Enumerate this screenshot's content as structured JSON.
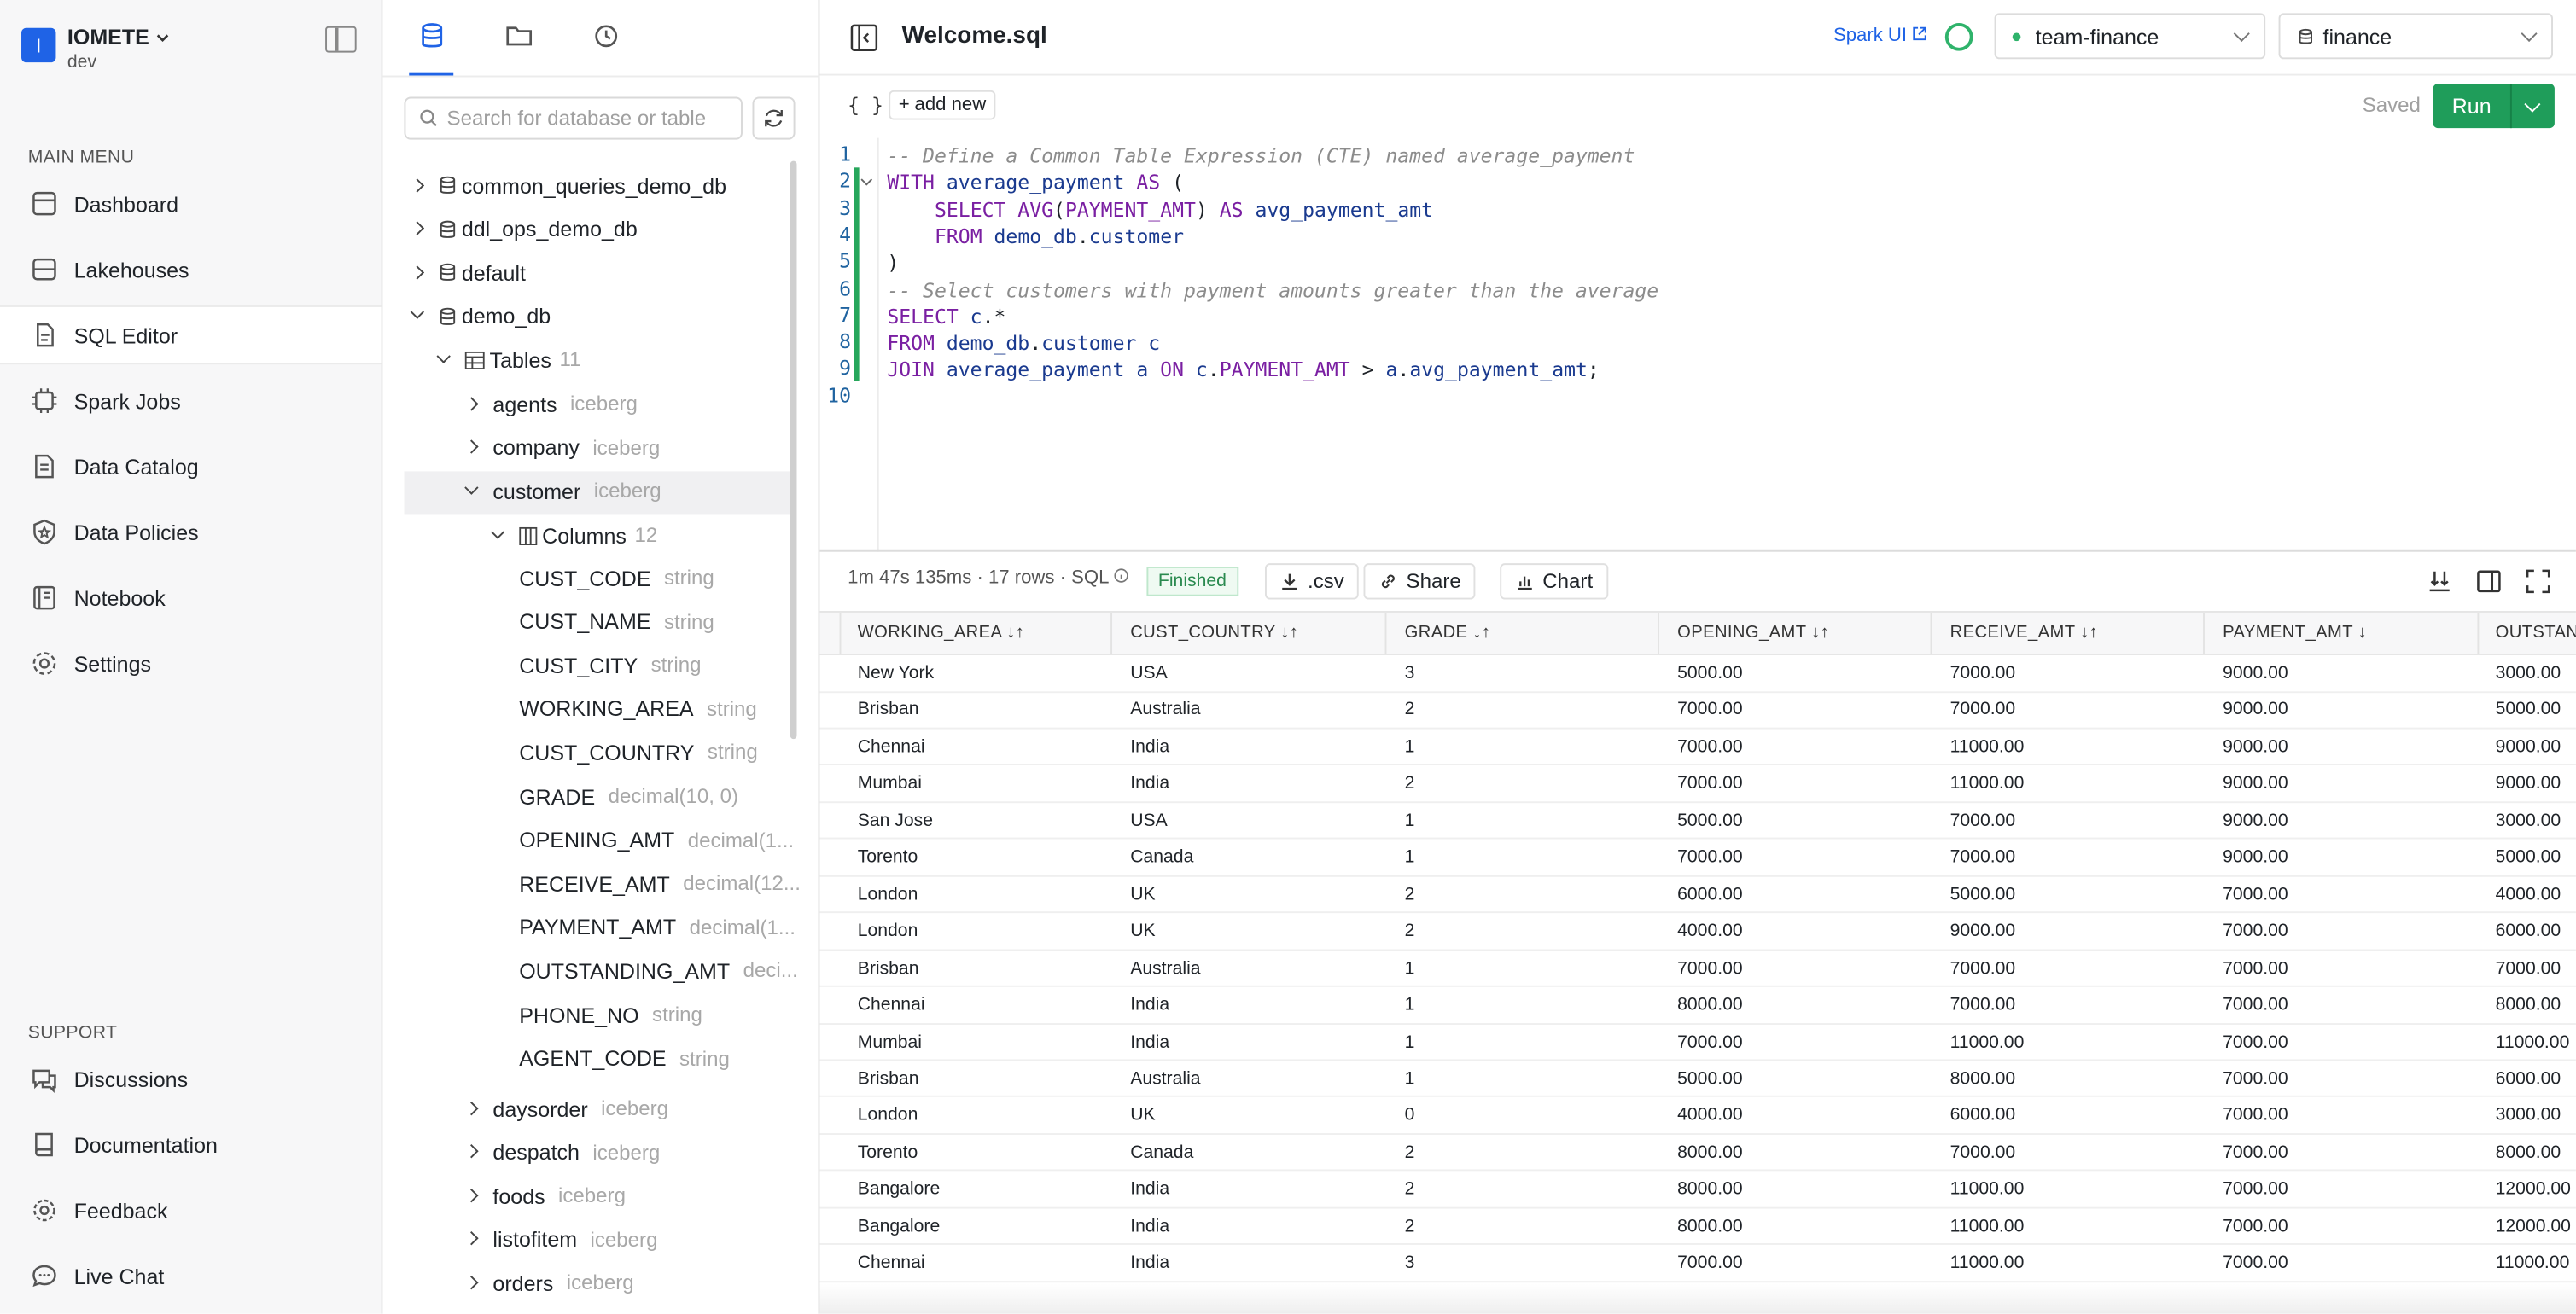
{
  "brand": {
    "logo_letter": "I",
    "name": "IOMETE",
    "env": "dev"
  },
  "sidebar": {
    "main_menu_label": "MAIN MENU",
    "items": [
      {
        "label": "Dashboard",
        "icon": "dashboard-icon"
      },
      {
        "label": "Lakehouses",
        "icon": "lakehouse-icon"
      },
      {
        "label": "SQL Editor",
        "icon": "sql-editor-icon"
      },
      {
        "label": "Spark Jobs",
        "icon": "spark-jobs-icon"
      },
      {
        "label": "Data Catalog",
        "icon": "data-catalog-icon"
      },
      {
        "label": "Data Policies",
        "icon": "data-policies-icon"
      },
      {
        "label": "Notebook",
        "icon": "notebook-icon"
      },
      {
        "label": "Settings",
        "icon": "settings-icon"
      }
    ],
    "support_label": "SUPPORT",
    "support_items": [
      {
        "label": "Discussions"
      },
      {
        "label": "Documentation"
      },
      {
        "label": "Feedback"
      },
      {
        "label": "Live Chat"
      }
    ]
  },
  "explorer": {
    "search_placeholder": "Search for database or table",
    "dbs": [
      "common_queries_demo_db",
      "ddl_ops_demo_db",
      "default",
      "demo_db"
    ],
    "tables_label": "Tables",
    "tables_count": "11",
    "tables_before": [
      {
        "name": "agents",
        "fmt": "iceberg"
      },
      {
        "name": "company",
        "fmt": "iceberg"
      },
      {
        "name": "customer",
        "fmt": "iceberg"
      }
    ],
    "columns_label": "Columns",
    "columns_count": "12",
    "columns": [
      {
        "name": "CUST_CODE",
        "type": "string"
      },
      {
        "name": "CUST_NAME",
        "type": "string"
      },
      {
        "name": "CUST_CITY",
        "type": "string"
      },
      {
        "name": "WORKING_AREA",
        "type": "string"
      },
      {
        "name": "CUST_COUNTRY",
        "type": "string"
      },
      {
        "name": "GRADE",
        "type": "decimal(10, 0)"
      },
      {
        "name": "OPENING_AMT",
        "type": "decimal(1..."
      },
      {
        "name": "RECEIVE_AMT",
        "type": "decimal(12..."
      },
      {
        "name": "PAYMENT_AMT",
        "type": "decimal(1..."
      },
      {
        "name": "OUTSTANDING_AMT",
        "type": "deci..."
      },
      {
        "name": "PHONE_NO",
        "type": "string"
      },
      {
        "name": "AGENT_CODE",
        "type": "string"
      }
    ],
    "tables_after": [
      {
        "name": "daysorder",
        "fmt": "iceberg"
      },
      {
        "name": "despatch",
        "fmt": "iceberg"
      },
      {
        "name": "foods",
        "fmt": "iceberg"
      },
      {
        "name": "listofitem",
        "fmt": "iceberg"
      },
      {
        "name": "orders",
        "fmt": "iceberg"
      }
    ]
  },
  "editor": {
    "file_name": "Welcome.sql",
    "spark_ui": "Spark UI",
    "cluster": "team-finance",
    "catalog": "finance",
    "braces": "{ }",
    "add_new": "add new",
    "saved": "Saved",
    "run": "Run",
    "line_numbers": [
      "1",
      "2",
      "3",
      "4",
      "5",
      "6",
      "7",
      "8",
      "9",
      "10"
    ],
    "lines": [
      [
        [
          "cm",
          "-- Define a Common Table Expression (CTE) named average_payment"
        ]
      ],
      [
        [
          "kw",
          "WITH "
        ],
        [
          "id",
          "average_payment "
        ],
        [
          "kw",
          "AS "
        ],
        [
          "pl",
          "("
        ]
      ],
      [
        [
          "pl",
          "    "
        ],
        [
          "kw",
          "SELECT AVG"
        ],
        [
          "pl",
          "("
        ],
        [
          "kw",
          "PAYMENT_AMT"
        ],
        [
          "pl",
          ") "
        ],
        [
          "kw",
          "AS "
        ],
        [
          "id",
          "avg_payment_amt"
        ]
      ],
      [
        [
          "pl",
          "    "
        ],
        [
          "kw",
          "FROM "
        ],
        [
          "id",
          "demo_db"
        ],
        [
          "pl",
          "."
        ],
        [
          "id",
          "customer"
        ]
      ],
      [
        [
          "pl",
          ")"
        ]
      ],
      [
        [
          "cm",
          "-- Select customers with payment amounts greater than the average"
        ]
      ],
      [
        [
          "kw",
          "SELECT "
        ],
        [
          "id",
          "c"
        ],
        [
          "pl",
          ".*"
        ]
      ],
      [
        [
          "kw",
          "FROM "
        ],
        [
          "id",
          "demo_db"
        ],
        [
          "pl",
          "."
        ],
        [
          "id",
          "customer c"
        ]
      ],
      [
        [
          "kw",
          "JOIN "
        ],
        [
          "id",
          "average_payment a "
        ],
        [
          "kw",
          "ON "
        ],
        [
          "id",
          "c"
        ],
        [
          "pl",
          "."
        ],
        [
          "kw",
          "PAYMENT_AMT"
        ],
        [
          "pl",
          " > "
        ],
        [
          "id",
          "a"
        ],
        [
          "pl",
          "."
        ],
        [
          "id",
          "avg_payment_amt"
        ],
        [
          "pl",
          ";"
        ]
      ],
      []
    ]
  },
  "results": {
    "stats": "1m 47s 135ms · 17 rows · SQL",
    "status": "Finished",
    "csv": ".csv",
    "share": "Share",
    "chart": "Chart",
    "columns": [
      "WORKING_AREA ↓↑",
      "CUST_COUNTRY ↓↑",
      "GRADE ↓↑",
      "OPENING_AMT ↓↑",
      "RECEIVE_AMT ↓↑",
      "PAYMENT_AMT ↓",
      "OUTSTAN"
    ],
    "rows": [
      [
        "New York",
        "USA",
        "3",
        "5000.00",
        "7000.00",
        "9000.00",
        "3000.00"
      ],
      [
        "Brisban",
        "Australia",
        "2",
        "7000.00",
        "7000.00",
        "9000.00",
        "5000.00"
      ],
      [
        "Chennai",
        "India",
        "1",
        "7000.00",
        "11000.00",
        "9000.00",
        "9000.00"
      ],
      [
        "Mumbai",
        "India",
        "2",
        "7000.00",
        "11000.00",
        "9000.00",
        "9000.00"
      ],
      [
        "San Jose",
        "USA",
        "1",
        "5000.00",
        "7000.00",
        "9000.00",
        "3000.00"
      ],
      [
        "Torento",
        "Canada",
        "1",
        "7000.00",
        "7000.00",
        "9000.00",
        "5000.00"
      ],
      [
        "London",
        "UK",
        "2",
        "6000.00",
        "5000.00",
        "7000.00",
        "4000.00"
      ],
      [
        "London",
        "UK",
        "2",
        "4000.00",
        "9000.00",
        "7000.00",
        "6000.00"
      ],
      [
        "Brisban",
        "Australia",
        "1",
        "7000.00",
        "7000.00",
        "7000.00",
        "7000.00"
      ],
      [
        "Chennai",
        "India",
        "1",
        "8000.00",
        "7000.00",
        "7000.00",
        "8000.00"
      ],
      [
        "Mumbai",
        "India",
        "1",
        "7000.00",
        "11000.00",
        "7000.00",
        "11000.00"
      ],
      [
        "Brisban",
        "Australia",
        "1",
        "5000.00",
        "8000.00",
        "7000.00",
        "6000.00"
      ],
      [
        "London",
        "UK",
        "0",
        "4000.00",
        "6000.00",
        "7000.00",
        "3000.00"
      ],
      [
        "Torento",
        "Canada",
        "2",
        "8000.00",
        "7000.00",
        "7000.00",
        "8000.00"
      ],
      [
        "Bangalore",
        "India",
        "2",
        "8000.00",
        "11000.00",
        "7000.00",
        "12000.00"
      ],
      [
        "Bangalore",
        "India",
        "2",
        "8000.00",
        "11000.00",
        "7000.00",
        "12000.00"
      ],
      [
        "Chennai",
        "India",
        "3",
        "7000.00",
        "11000.00",
        "7000.00",
        "11000.00"
      ]
    ]
  },
  "colors": {
    "accent": "#1f63e6",
    "run": "#1f9d5a",
    "status_ok": "#2fb36b"
  }
}
